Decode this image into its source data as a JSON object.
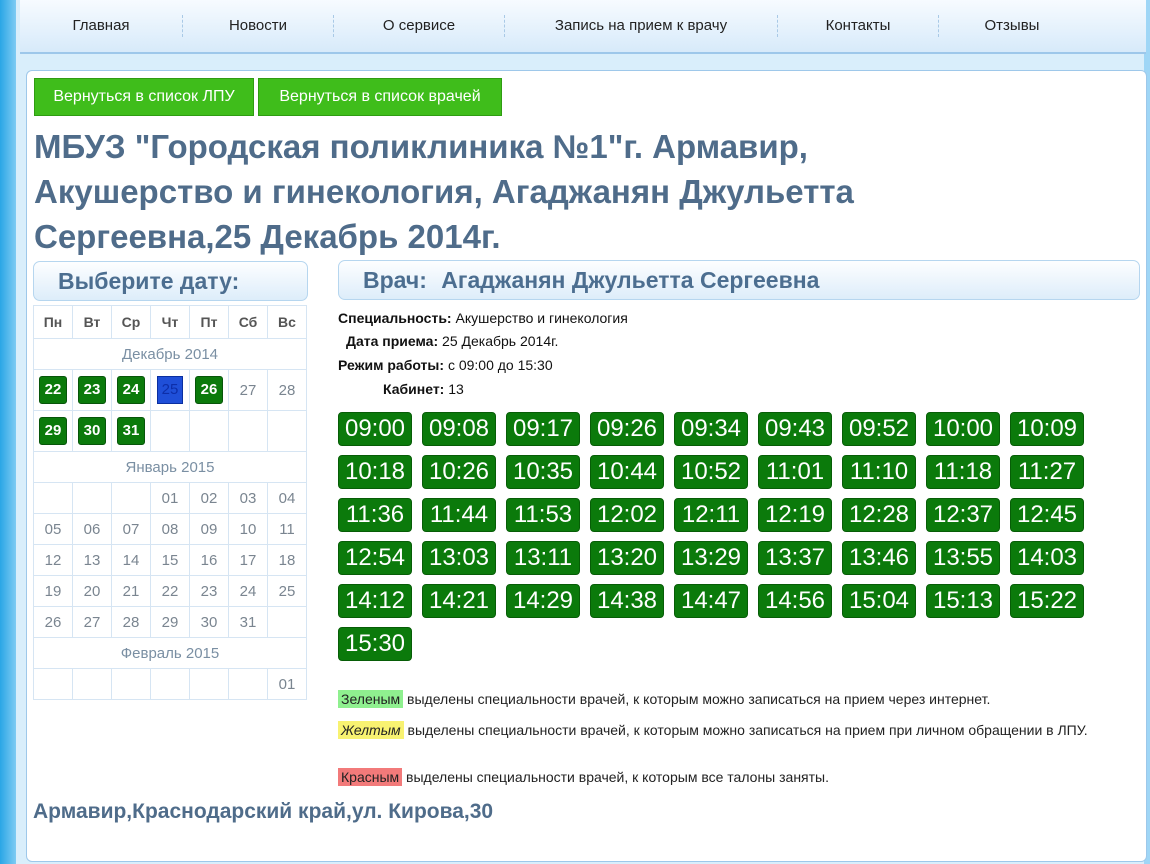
{
  "nav": {
    "items": [
      "Главная",
      "Новости",
      "О сервисе",
      "Запись на прием к врачу",
      "Контакты",
      "Отзывы"
    ]
  },
  "buttons": {
    "back_lpu": "Вернуться в список ЛПУ",
    "back_doctors": "Вернуться в список врачей"
  },
  "title": {
    "line1": "МБУЗ \"Городская поликлиника №1\"г. Армавир,",
    "line2": "Акушерство и гинекология, Агаджанян Джульетта",
    "line3": "Сергеевна,25 Декабрь 2014г."
  },
  "calendar": {
    "heading": "Выберите дату:",
    "weekdays": [
      "Пн",
      "Вт",
      "Ср",
      "Чт",
      "Пт",
      "Сб",
      "Вс"
    ],
    "months": {
      "dec": "Декабрь 2014",
      "jan": "Январь 2015",
      "feb": "Февраль 2015"
    },
    "dec_week1": [
      "22",
      "23",
      "24",
      "25",
      "26",
      "27",
      "28"
    ],
    "dec_week2": [
      "29",
      "30",
      "31"
    ],
    "jan_week1": [
      "01",
      "02",
      "03",
      "04"
    ],
    "jan_week2": [
      "05",
      "06",
      "07",
      "08",
      "09",
      "10",
      "11"
    ],
    "jan_week3": [
      "12",
      "13",
      "14",
      "15",
      "16",
      "17",
      "18"
    ],
    "jan_week4": [
      "19",
      "20",
      "21",
      "22",
      "23",
      "24",
      "25"
    ],
    "jan_week5": [
      "26",
      "27",
      "28",
      "29",
      "30",
      "31"
    ],
    "feb_week1": [
      "01"
    ],
    "colors": {
      "available": "#0b7a0b",
      "selected": "#1f4fd8"
    }
  },
  "doctor": {
    "heading_label": "Врач:",
    "heading_name": "Агаджанян Джульетта Сергеевна",
    "specialty_label": "Специальность:",
    "specialty": "Акушерство и гинекология",
    "date_label": "Дата приема:",
    "date": "25 Декабрь 2014г.",
    "hours_label": "Режим работы:",
    "hours": "с 09:00 до 15:30",
    "room_label": "Кабинет:",
    "room": "13"
  },
  "slots": [
    "09:00",
    "09:08",
    "09:17",
    "09:26",
    "09:34",
    "09:43",
    "09:52",
    "10:00",
    "10:09",
    "10:18",
    "10:26",
    "10:35",
    "10:44",
    "10:52",
    "11:01",
    "11:10",
    "11:18",
    "11:27",
    "11:36",
    "11:44",
    "11:53",
    "12:02",
    "12:11",
    "12:19",
    "12:28",
    "12:37",
    "12:45",
    "12:54",
    "13:03",
    "13:11",
    "13:20",
    "13:29",
    "13:37",
    "13:46",
    "13:55",
    "14:03",
    "14:12",
    "14:21",
    "14:29",
    "14:38",
    "14:47",
    "14:56",
    "15:04",
    "15:13",
    "15:22",
    "15:30"
  ],
  "legend": {
    "green_tag": "Зеленым",
    "green_text": "выделены специальности врачей, к которым можно записаться на прием через интернет.",
    "yellow_tag": "Желтым",
    "yellow_text": "выделены специальности врачей, к которым можно записаться на прием при личном обращении в ЛПУ.",
    "red_tag": "Красным",
    "red_text": "выделены специальности врачей, к которым все талоны заняты."
  },
  "address": "Армавир,Краснодарский край,ул. Кирова,30"
}
